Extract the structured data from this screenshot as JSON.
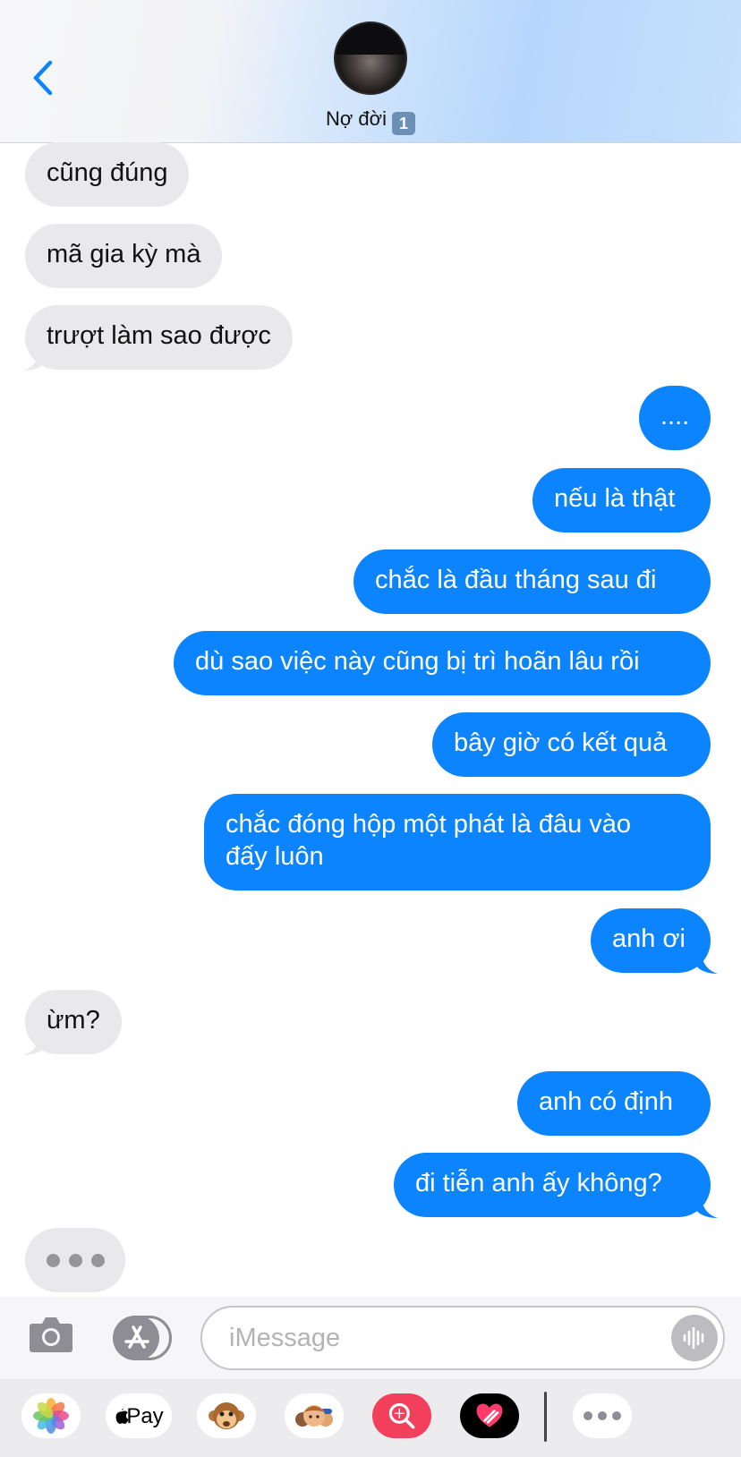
{
  "header": {
    "contact_name": "Nợ đời",
    "badge": "1"
  },
  "messages": [
    {
      "dir": "in",
      "text": "cũng đúng"
    },
    {
      "dir": "in",
      "text": "mã gia kỳ mà"
    },
    {
      "dir": "in",
      "text": "trượt làm sao được"
    },
    {
      "dir": "out",
      "text": "...."
    },
    {
      "dir": "out",
      "text": "nếu là thật"
    },
    {
      "dir": "out",
      "text": "chắc là đầu tháng sau đi"
    },
    {
      "dir": "out",
      "text": "dù sao việc này cũng bị trì hoãn lâu rồi"
    },
    {
      "dir": "out",
      "text": "bây giờ có kết quả"
    },
    {
      "dir": "out",
      "text": [
        "chắc đóng hộp một phát là đâu vào",
        "đấy luôn"
      ]
    },
    {
      "dir": "out",
      "text": "anh ơi"
    },
    {
      "dir": "in",
      "text": "ừm?"
    },
    {
      "dir": "out",
      "text": "anh có định"
    },
    {
      "dir": "out",
      "text": "đi tiễn anh ấy không?"
    }
  ],
  "input": {
    "placeholder": "iMessage"
  },
  "apps": {
    "apple_pay_label": "Pay"
  },
  "icons": [
    "chevron-left-icon",
    "camera-icon",
    "app-store-icon",
    "audio-waveform-icon",
    "photos-icon",
    "apple-pay-icon",
    "animoji-monkey-icon",
    "memoji-icon",
    "image-search-icon",
    "digital-touch-icon",
    "more-apps-icon"
  ],
  "colors": {
    "outgoing_bubble": "#0b84fe",
    "incoming_bubble": "#e9e9eb",
    "accent": "#0b84fe"
  }
}
